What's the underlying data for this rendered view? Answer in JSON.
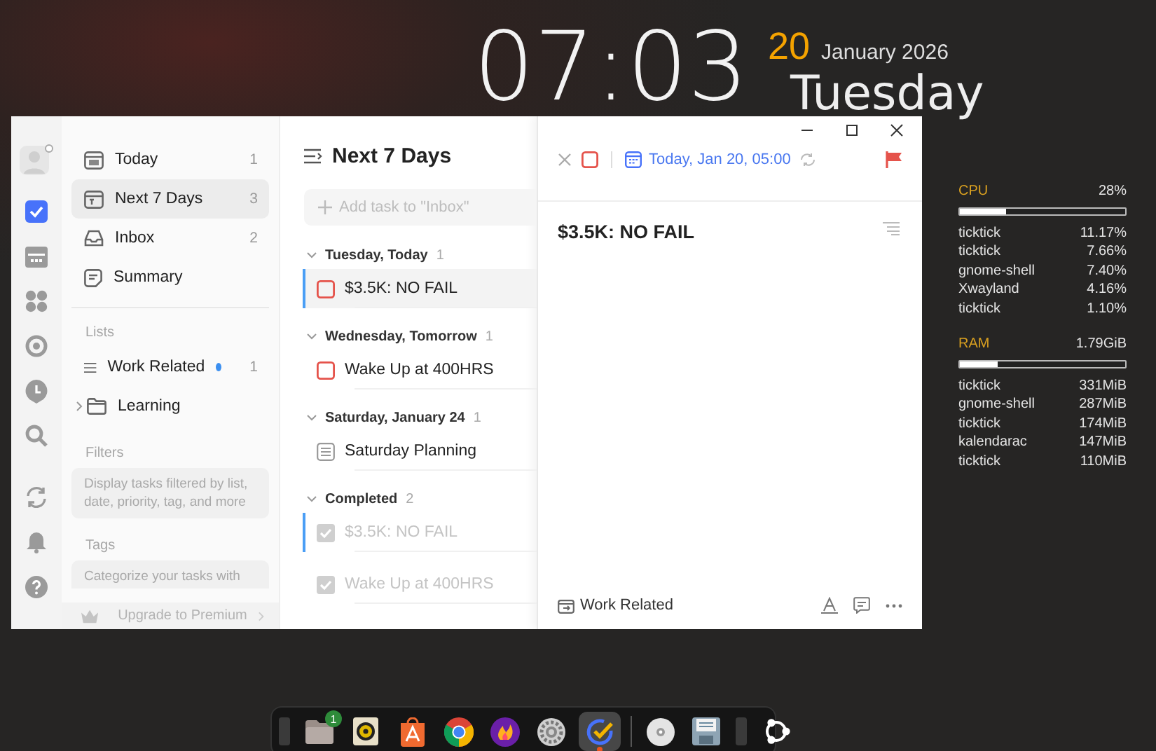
{
  "clock": {
    "time": "07:03",
    "day": "20",
    "month_year": "January 2026",
    "weekday": "Tuesday"
  },
  "rail": {
    "top": [
      {
        "kind": "avatar",
        "selected": false
      },
      {
        "kind": "tasks",
        "selected": true
      },
      {
        "kind": "calendar",
        "selected": false
      },
      {
        "kind": "matrix",
        "selected": false
      },
      {
        "kind": "focus",
        "selected": false
      },
      {
        "kind": "habit",
        "selected": false
      },
      {
        "kind": "search",
        "selected": false
      }
    ],
    "bottom": [
      {
        "kind": "sync"
      },
      {
        "kind": "bell"
      },
      {
        "kind": "help"
      }
    ]
  },
  "sidebar": {
    "smart_lists": [
      {
        "kind": "today",
        "label": "Today",
        "count": "1",
        "selected": false
      },
      {
        "kind": "week",
        "label": "Next 7 Days",
        "count": "3",
        "selected": true
      },
      {
        "kind": "inbox",
        "label": "Inbox",
        "count": "2",
        "selected": false
      },
      {
        "kind": "summary",
        "label": "Summary",
        "selected": false
      }
    ],
    "lists_title": "Lists",
    "lists": [
      {
        "kind": "list",
        "label": "Work Related",
        "count": "1",
        "color": "#3b8ff0",
        "selected": false
      },
      {
        "kind": "folder",
        "label": "Learning",
        "selected": false
      }
    ],
    "filters_title": "Filters",
    "filters_hint": "Display tasks filtered by list, date, priority, tag, and more",
    "tags_title": "Tags",
    "tags_hint": "Categorize your tasks with",
    "upgrade": "Upgrade to Premium"
  },
  "task_list": {
    "title": "Next 7 Days",
    "add_placeholder": "Add task to \"Inbox\"",
    "groups": [
      {
        "title": "Tuesday, Today",
        "count": "1",
        "expanded": true,
        "tasks": [
          {
            "kind": "task",
            "title": "$3.5K: NO FAIL",
            "high_priority": true,
            "checked": false,
            "selected": true,
            "accent": true
          }
        ]
      },
      {
        "title": "Wednesday, Tomorrow",
        "count": "1",
        "expanded": true,
        "tasks": [
          {
            "kind": "task",
            "title": "Wake Up at 400HRS",
            "high_priority": true,
            "checked": false,
            "selected": false,
            "accent": false
          }
        ]
      },
      {
        "title": "Saturday, January 24",
        "count": "1",
        "expanded": true,
        "tasks": [
          {
            "kind": "note",
            "title": "Saturday Planning",
            "selected": false,
            "accent": false
          }
        ]
      },
      {
        "title": "Completed",
        "count": "2",
        "expanded": true,
        "tasks": [
          {
            "kind": "task",
            "title": "$3.5K: NO FAIL",
            "high_priority": true,
            "checked": true,
            "selected": false,
            "accent": true
          },
          {
            "kind": "task",
            "title": "Wake Up at 400HRS",
            "high_priority": true,
            "checked": true,
            "selected": false,
            "accent": false
          }
        ]
      }
    ]
  },
  "detail": {
    "high_priority": true,
    "checked": false,
    "due": "Today, Jan 20, 05:00",
    "repeat": true,
    "flagged": true,
    "title": "$3.5K: NO FAIL",
    "list": "Work Related"
  },
  "monitor": {
    "sections": [
      {
        "label": "CPU",
        "value": "28%",
        "level": 0.28,
        "processes": [
          {
            "name": "ticktick",
            "value": "11.17%"
          },
          {
            "name": "ticktick",
            "value": "7.66%"
          },
          {
            "name": "gnome-shell",
            "value": "7.40%"
          },
          {
            "name": "Xwayland",
            "value": "4.16%"
          },
          {
            "name": "ticktick",
            "value": "1.10%"
          }
        ]
      },
      {
        "label": "RAM",
        "value": "1.79GiB",
        "level": 0.23,
        "processes": [
          {
            "name": "ticktick",
            "value": "331MiB"
          },
          {
            "name": "gnome-shell",
            "value": "287MiB"
          },
          {
            "name": "ticktick",
            "value": "174MiB"
          },
          {
            "name": "kalendarac",
            "value": "147MiB"
          },
          {
            "name": "ticktick",
            "value": "110MiB"
          }
        ]
      }
    ]
  },
  "dock": [
    {
      "kind": "stub",
      "selected": false
    },
    {
      "kind": "folder",
      "badge": "1",
      "selected": false
    },
    {
      "kind": "speaker",
      "selected": false
    },
    {
      "kind": "store",
      "selected": false
    },
    {
      "kind": "browser",
      "selected": false
    },
    {
      "kind": "flame",
      "selected": false
    },
    {
      "kind": "gear",
      "selected": false
    },
    {
      "kind": "check",
      "selected": true
    },
    {
      "kind": "separator"
    },
    {
      "kind": "disc",
      "selected": false
    },
    {
      "kind": "floppy",
      "selected": false
    },
    {
      "kind": "stub",
      "selected": false
    },
    {
      "kind": "ring",
      "selected": false
    }
  ]
}
